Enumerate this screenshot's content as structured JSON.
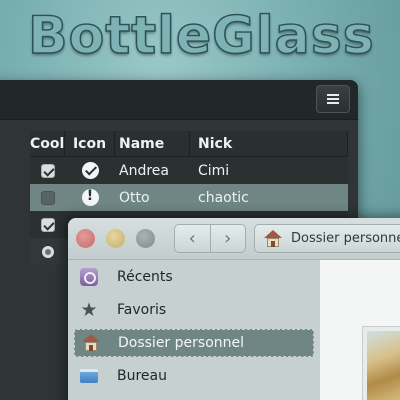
{
  "banner": {
    "title": "BottleGlass"
  },
  "back_window": {
    "menu_icon": "hamburger-menu-icon",
    "table": {
      "headers": {
        "cool": "Cool",
        "icon": "Icon",
        "name": "Name",
        "nick": "Nick"
      },
      "rows": [
        {
          "cool": "checked",
          "icon": "check-circle-icon",
          "name": "Andrea",
          "nick": "Cimi"
        },
        {
          "cool": "unchecked",
          "icon": "warning-circle-icon",
          "name": "Otto",
          "nick": "chaotic",
          "selected": true
        },
        {
          "cool": "checked",
          "icon": "",
          "name": "",
          "nick": ""
        },
        {
          "cool": "radio",
          "icon": "",
          "name": "",
          "nick": ""
        }
      ]
    }
  },
  "front_window": {
    "toolbar": {
      "back_icon": "chevron-left-icon",
      "forward_icon": "chevron-right-icon",
      "location_label": "Dossier personnel"
    },
    "sidebar": {
      "items": [
        {
          "label": "Récents",
          "icon": "recent-icon"
        },
        {
          "label": "Favoris",
          "icon": "star-icon"
        },
        {
          "label": "Dossier personnel",
          "icon": "home-icon",
          "selected": true
        },
        {
          "label": "Bureau",
          "icon": "desktop-icon"
        }
      ]
    }
  },
  "colors": {
    "selection": "#6f8685",
    "dark_window": "#2f3535",
    "light_window": "#cdd6d6"
  }
}
